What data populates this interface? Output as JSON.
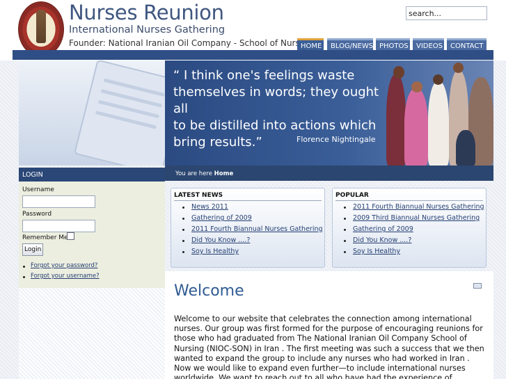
{
  "header": {
    "title": "Nurses Reunion",
    "subtitle": "International Nurses Gathering",
    "founder": "Founder: National Iranian Oil Company - School of Nursing",
    "search_placeholder": "search..."
  },
  "nav": [
    {
      "label": "HOME"
    },
    {
      "label": "BLOG/NEWS"
    },
    {
      "label": "PHOTOS"
    },
    {
      "label": "VIDEOS"
    },
    {
      "label": "CONTACT"
    }
  ],
  "banner": {
    "quote_line1": "“ I think one's feelings waste",
    "quote_line2": "themselves in words; they ought all",
    "quote_line3": "to be distilled into actions which",
    "quote_line4": "bring results.”",
    "author": "Florence Nightingale"
  },
  "login": {
    "heading": "LOGIN",
    "username_label": "Username",
    "password_label": "Password",
    "remember_label": "Remember Me",
    "button_label": "Login",
    "forgot_password": "Forgot your password?",
    "forgot_username": "Forgot your username?"
  },
  "breadcrumb": {
    "prefix": "You are here",
    "current": "Home"
  },
  "latest_news": {
    "title": "LATEST NEWS",
    "items": [
      "News 2011",
      "Gathering of 2009",
      "2011 Fourth Biannual Nurses Gathering",
      "Did You Know ....?",
      "Soy Is Healthy"
    ]
  },
  "popular": {
    "title": "POPULAR",
    "items": [
      "2011 Fourth Biannual Nurses Gathering",
      "2009 Third Biannual Nurses Gathering",
      "Gathering of 2009",
      "Did You Know ....?",
      "Soy Is Healthy"
    ]
  },
  "main": {
    "heading": "Welcome",
    "body": "Welcome to our website that celebrates the connection among international nurses. Our group was first formed for the purpose of encouraging reunions for those who had graduated from The National Iranian Oil Company School of Nursing (NIOC-SON) in Iran . The first meeting was such a success that we then wanted to expand the group to include any nurses who had worked in Iran . Now we would like to expand even further—to include international nurses worldwide. We want to reach out to all who have had the experience of working in international settings."
  },
  "colors": {
    "brand_blue": "#2f4e85",
    "title_blue": "#3f5680",
    "link_blue": "#243e72",
    "nav_active_top": "#e0a23b"
  }
}
